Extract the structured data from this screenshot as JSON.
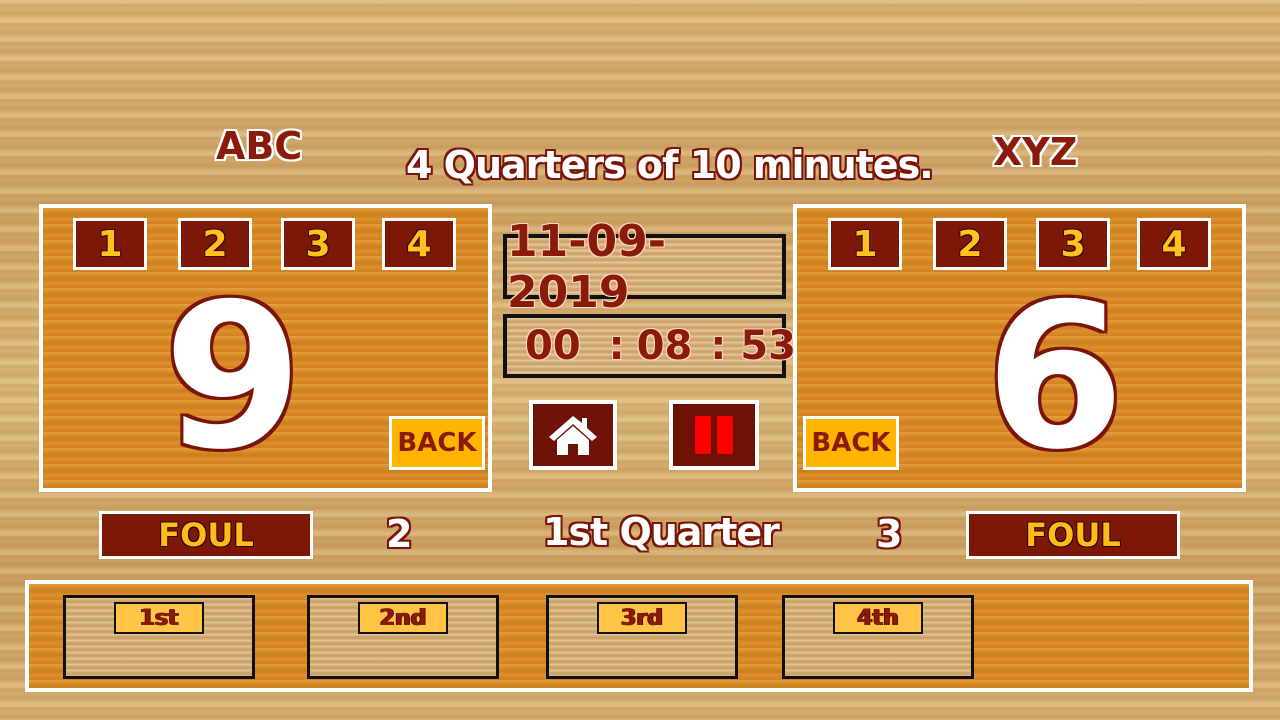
{
  "header": {
    "team_left": "ABC",
    "team_right": "XYZ",
    "game_format": "4 Quarters of 10 minutes."
  },
  "left_team": {
    "quarters": [
      "1",
      "2",
      "3",
      "4"
    ],
    "score": "9",
    "back_label": "BACK",
    "foul_label": "FOUL",
    "fouls": "2"
  },
  "right_team": {
    "quarters": [
      "1",
      "2",
      "3",
      "4"
    ],
    "score": "6",
    "back_label": "BACK",
    "foul_label": "FOUL",
    "fouls": "3"
  },
  "center": {
    "date": "11-09-2019",
    "clock": {
      "hours": "00",
      "minutes": "08",
      "seconds": "53",
      "separator": ":"
    },
    "home_icon": "home-icon",
    "pause_icon": "pause-icon",
    "current_period": "1st Quarter"
  },
  "periods": {
    "labels": [
      "1st",
      "2nd",
      "3rd",
      "4th"
    ]
  },
  "colors": {
    "maroon": "#7d1707",
    "gold": "#ffbb18",
    "back_yellow": "#ffb400",
    "pause_red": "#ff0000",
    "panel_orange": "#d98a26"
  }
}
